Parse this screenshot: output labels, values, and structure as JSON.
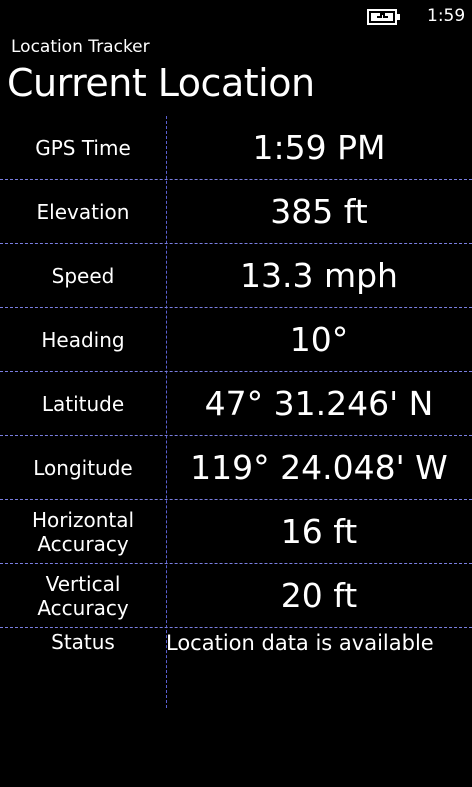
{
  "status_bar": {
    "battery_icon": "battery-charging-icon",
    "time": "1:59"
  },
  "header": {
    "app_title": "Location Tracker",
    "page_title": "Current Location"
  },
  "rows": [
    {
      "label": "GPS Time",
      "value": "1:59 PM"
    },
    {
      "label": "Elevation",
      "value": "385 ft"
    },
    {
      "label": "Speed",
      "value": "13.3 mph"
    },
    {
      "label": "Heading",
      "value": "10°"
    },
    {
      "label": "Latitude",
      "value": "47° 31.246' N"
    },
    {
      "label": "Longitude",
      "value": "119° 24.048' W"
    },
    {
      "label": "Horizontal\nAccuracy",
      "value": "16 ft"
    },
    {
      "label": "Vertical\nAccuracy",
      "value": "20 ft"
    },
    {
      "label": "Status",
      "value": "Location data is available"
    }
  ],
  "colors": {
    "background": "#000000",
    "text": "#ffffff",
    "grid_line": "#5b5fd0"
  }
}
